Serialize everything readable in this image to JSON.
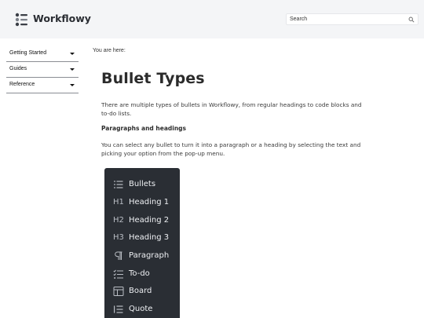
{
  "header": {
    "brand": "Workflowy",
    "search_placeholder": "Search"
  },
  "sidebar": {
    "items": [
      {
        "label": "Getting Started"
      },
      {
        "label": "Guides"
      },
      {
        "label": "Reference"
      }
    ]
  },
  "main": {
    "breadcrumb": "You are here:",
    "title": "Bullet Types",
    "intro": "There are multiple types of bullets in Workflowy, from regular headings to code blocks and to-do lists.",
    "section_heading": "Paragraphs and headings",
    "section_text": "You can select any bullet to turn it into a paragraph or a heading by selecting the text and picking your option from the pop-up menu."
  },
  "menu": {
    "items": [
      {
        "icon_text": "",
        "icon": "bullets-icon",
        "label": "Bullets"
      },
      {
        "icon_text": "H1",
        "icon": "heading-1-icon",
        "label": "Heading 1"
      },
      {
        "icon_text": "H2",
        "icon": "heading-2-icon",
        "label": "Heading 2"
      },
      {
        "icon_text": "H3",
        "icon": "heading-3-icon",
        "label": "Heading 3"
      },
      {
        "icon_text": "",
        "icon": "paragraph-icon",
        "label": "Paragraph"
      },
      {
        "icon_text": "",
        "icon": "todo-icon",
        "label": "To-do"
      },
      {
        "icon_text": "",
        "icon": "board-icon",
        "label": "Board"
      },
      {
        "icon_text": "",
        "icon": "quote-icon",
        "label": "Quote"
      }
    ]
  },
  "colors": {
    "header_bg": "#f4f5f7",
    "menu_bg": "#2a2e34",
    "menu_text": "#eef0f3",
    "menu_icon": "#b9bdc4"
  }
}
